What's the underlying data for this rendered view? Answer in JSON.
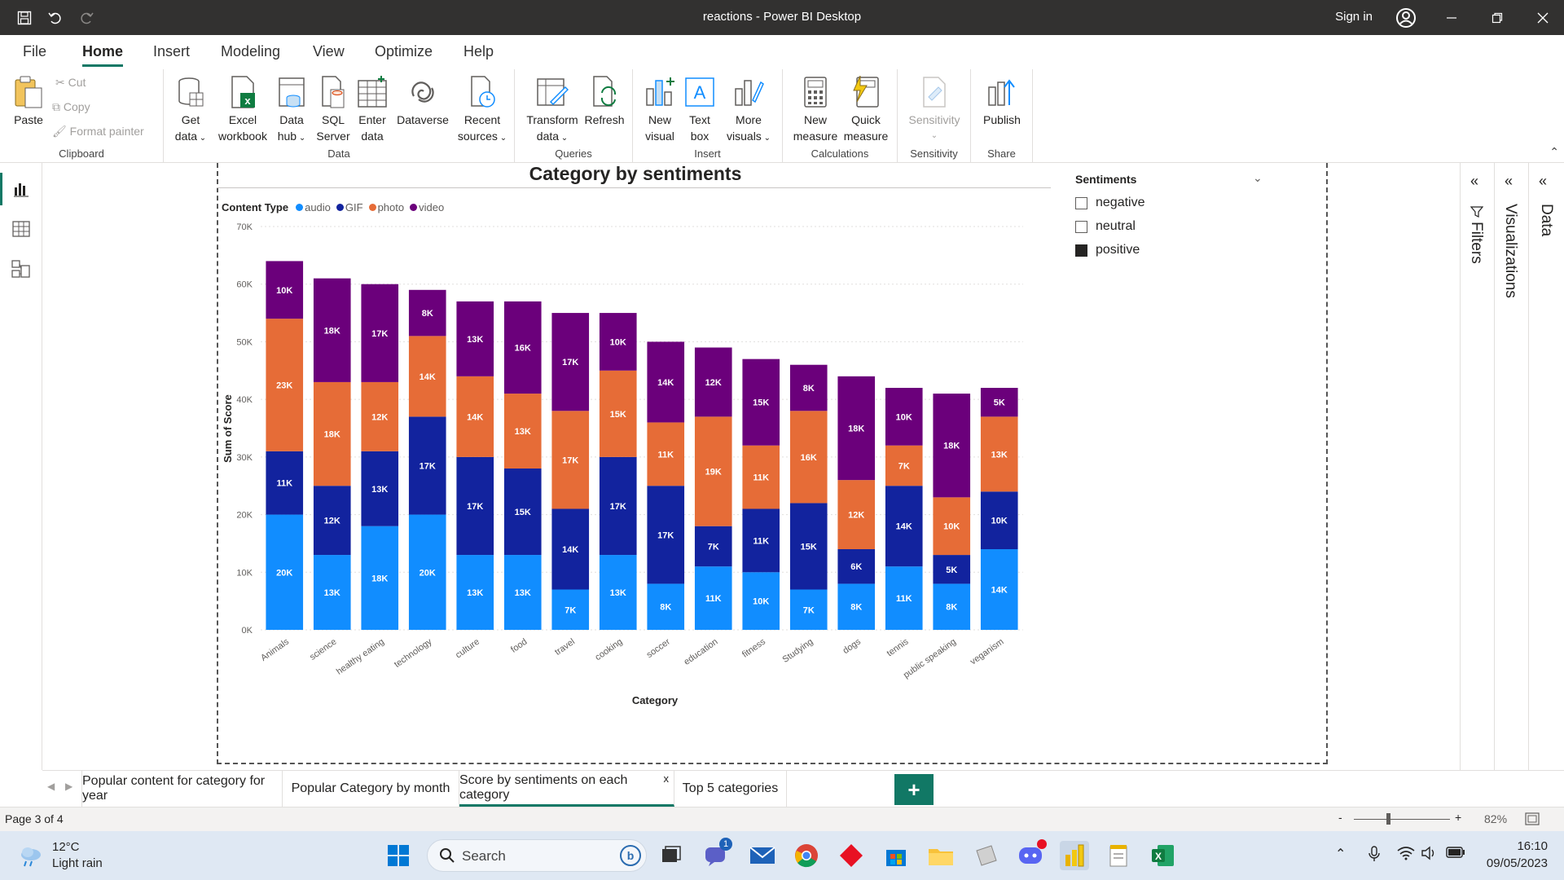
{
  "window": {
    "title": "reactions - Power BI Desktop",
    "sign_in": "Sign in"
  },
  "menu": [
    "File",
    "Home",
    "Insert",
    "Modeling",
    "View",
    "Optimize",
    "Help"
  ],
  "ribbon": {
    "clipboard": {
      "label": "Clipboard",
      "paste": "Paste",
      "cut": "Cut",
      "copy": "Copy",
      "format_painter": "Format painter"
    },
    "data": {
      "label": "Data",
      "get_data": [
        "Get",
        "data"
      ],
      "excel": [
        "Excel",
        "workbook"
      ],
      "data_hub": [
        "Data",
        "hub"
      ],
      "sql": [
        "SQL",
        "Server"
      ],
      "enter": [
        "Enter",
        "data"
      ],
      "dataverse": "Dataverse",
      "recent": [
        "Recent",
        "sources"
      ]
    },
    "queries": {
      "label": "Queries",
      "transform": [
        "Transform",
        "data"
      ],
      "refresh": "Refresh"
    },
    "insert": {
      "label": "Insert",
      "new_visual": [
        "New",
        "visual"
      ],
      "text_box": [
        "Text",
        "box"
      ],
      "more_visuals": [
        "More",
        "visuals"
      ]
    },
    "calculations": {
      "label": "Calculations",
      "new_measure": [
        "New",
        "measure"
      ],
      "quick_measure": [
        "Quick",
        "measure"
      ]
    },
    "sensitivity": {
      "label": "Sensitivity",
      "btn": "Sensitivity"
    },
    "share": {
      "label": "Share",
      "publish": "Publish"
    }
  },
  "panes": {
    "filters": "Filters",
    "visualizations": "Visualizations",
    "data": "Data"
  },
  "slicer": {
    "title": "Sentiments",
    "items": [
      {
        "label": "negative",
        "checked": false
      },
      {
        "label": "neutral",
        "checked": false
      },
      {
        "label": "positive",
        "checked": true
      }
    ]
  },
  "legend_title": "Content Type",
  "colors": {
    "audio": "#118dff",
    "GIF": "#12239e",
    "photo": "#e66c37",
    "video": "#6b007b",
    "accent": "#117865"
  },
  "chart_data": {
    "type": "bar",
    "stacked": true,
    "title": "Category by sentiments",
    "xlabel": "Category",
    "ylabel": "Sum of Score",
    "ylim": [
      0,
      70000
    ],
    "yticks": [
      "0K",
      "10K",
      "20K",
      "30K",
      "40K",
      "50K",
      "60K",
      "70K"
    ],
    "legend_placement": "top-left",
    "categories": [
      "Animals",
      "science",
      "healthy eating",
      "technology",
      "culture",
      "food",
      "travel",
      "cooking",
      "soccer",
      "education",
      "fitness",
      "Studying",
      "dogs",
      "tennis",
      "public speaking",
      "veganism"
    ],
    "series": [
      {
        "name": "audio",
        "values": [
          20000,
          13000,
          18000,
          20000,
          13000,
          13000,
          7000,
          13000,
          8000,
          11000,
          10000,
          7000,
          8000,
          11000,
          8000,
          14000
        ]
      },
      {
        "name": "GIF",
        "values": [
          11000,
          12000,
          13000,
          17000,
          17000,
          15000,
          14000,
          17000,
          17000,
          7000,
          11000,
          15000,
          6000,
          14000,
          5000,
          10000
        ]
      },
      {
        "name": "photo",
        "values": [
          23000,
          18000,
          12000,
          14000,
          14000,
          13000,
          17000,
          15000,
          11000,
          19000,
          11000,
          16000,
          12000,
          7000,
          10000,
          13000
        ]
      },
      {
        "name": "video",
        "values": [
          10000,
          18000,
          17000,
          8000,
          13000,
          16000,
          17000,
          10000,
          14000,
          12000,
          15000,
          8000,
          18000,
          10000,
          18000,
          5000
        ]
      }
    ],
    "data_labels": [
      [
        "20K",
        "13K",
        "18K",
        "20K",
        "13K",
        "13K",
        "7K",
        "13K",
        "8K",
        "11K",
        "10K",
        "7K",
        "8K",
        "11K",
        "8K",
        "14K"
      ],
      [
        "11K",
        "12K",
        "13K",
        "17K",
        "17K",
        "15K",
        "14K",
        "17K",
        "17K",
        "7K",
        "11K",
        "15K",
        "6K",
        "14K",
        "5K",
        "10K"
      ],
      [
        "23K",
        "18K",
        "12K",
        "14K",
        "14K",
        "13K",
        "17K",
        "15K",
        "11K",
        "19K",
        "11K",
        "16K",
        "12K",
        "7K",
        "10K",
        "13K"
      ],
      [
        "10K",
        "18K",
        "17K",
        "8K",
        "13K",
        "16K",
        "17K",
        "10K",
        "14K",
        "12K",
        "15K",
        "8K",
        "18K",
        "10K",
        "18K",
        "5K"
      ]
    ]
  },
  "page_tabs": [
    {
      "label": "Popular content for category for year",
      "active": false
    },
    {
      "label": "Popular Category by month",
      "active": false
    },
    {
      "label": "Score by sentiments on each category",
      "active": true
    },
    {
      "label": "Top 5 categories",
      "active": false
    }
  ],
  "status": {
    "page": "Page 3 of 4",
    "zoom": "82%"
  },
  "taskbar": {
    "temp": "12°C",
    "weather": "Light rain",
    "search": "Search",
    "time": "16:10",
    "date": "09/05/2023",
    "chat_badge": "1"
  }
}
